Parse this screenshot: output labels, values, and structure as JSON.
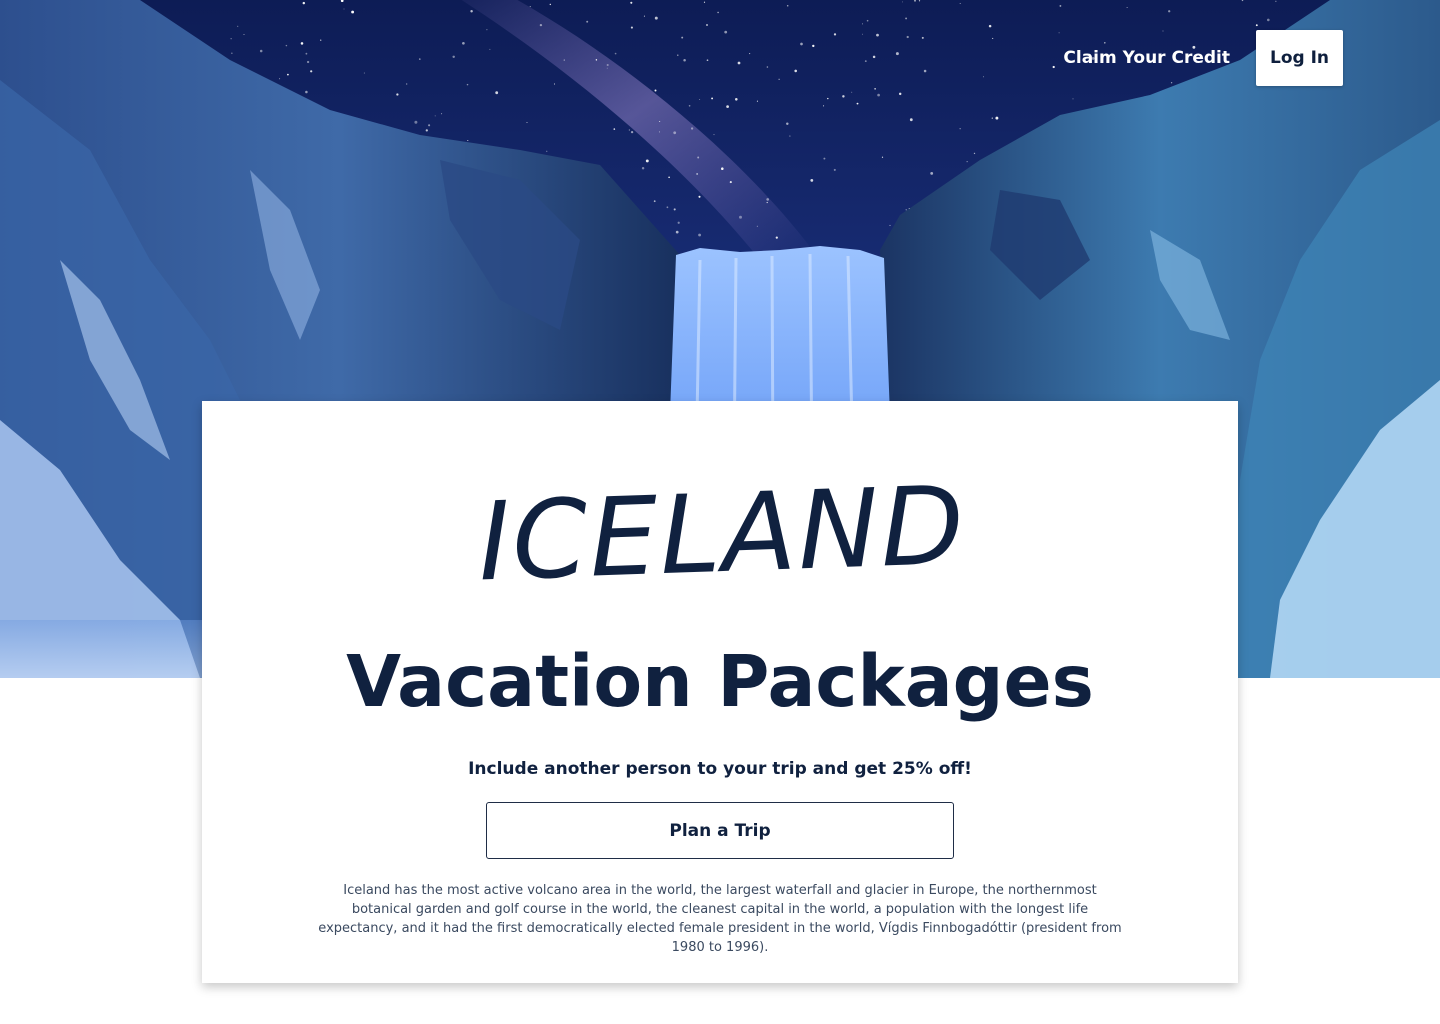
{
  "nav": {
    "claim_label": "Claim Your Credit",
    "login_label": "Log In"
  },
  "hero": {
    "logo_text": "ICELAND",
    "headline": "Vacation Packages",
    "promo": "Include another person to your trip and get 25% off!",
    "cta_label": "Plan a Trip",
    "description": "Iceland has the most active volcano area in the world, the largest waterfall and glacier in Europe, the northernmost botanical garden and golf course in the world, the cleanest capital in the world, a population with the longest life expectancy, and it had the first democratically elected female president in the world, Vígdis Finnbogadóttir (president from 1980 to 1996)."
  },
  "colors": {
    "navy": "#10213f",
    "sky": "#0b1d5c",
    "waterfall": "#4d8cff",
    "white": "#ffffff"
  }
}
